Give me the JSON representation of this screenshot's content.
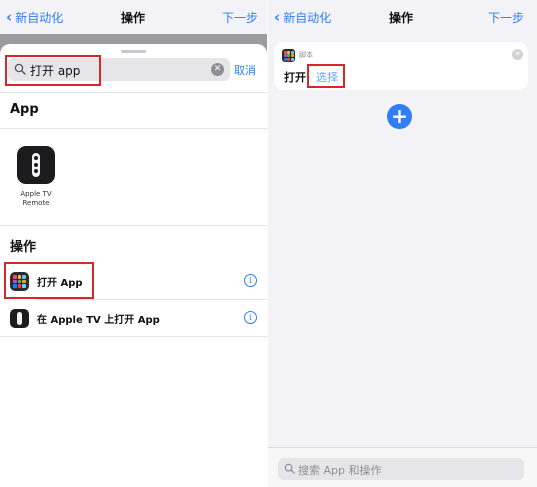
{
  "left": {
    "nav": {
      "back_label": "新自动化",
      "title": "操作",
      "next_label": "下一步"
    },
    "search": {
      "value": "打开 app",
      "cancel_label": "取消"
    },
    "sections": {
      "apps_title": "App",
      "actions_title": "操作"
    },
    "app_result": {
      "name_line1": "Apple TV",
      "name_line2": "Remote",
      "icon": "apple-tv-remote-icon"
    },
    "actions": [
      {
        "label": "打开 App",
        "icon": "shortcuts-app-grid-icon"
      },
      {
        "label": "在 Apple TV 上打开 App",
        "icon": "apple-tv-remote-icon"
      }
    ]
  },
  "right": {
    "nav": {
      "back_label": "新自动化",
      "title": "操作",
      "next_label": "下一步"
    },
    "card": {
      "app_name": "脚本",
      "verb": "打开",
      "param_placeholder": "选择"
    },
    "bottom_search": {
      "placeholder": "搜索 App 和操作"
    }
  },
  "colors": {
    "accent": "#2f7ef5",
    "highlight_box": "#d9262c",
    "sheet_dim": "#9b9ba0",
    "background": "#f2f2f7"
  }
}
